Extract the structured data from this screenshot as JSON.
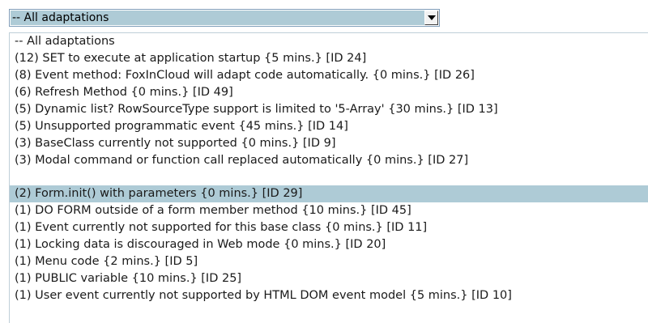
{
  "combo": {
    "selected_label": "-- All adaptations",
    "button_icon": "chevron-down-icon"
  },
  "dropdown": {
    "selected_index": 9,
    "selection_color": "#aecbd6",
    "options": [
      "-- All adaptations",
      "(12) SET to execute at application startup {5 mins.} [ID 24]",
      "(8) Event method: FoxInCloud will adapt code automatically. {0 mins.} [ID 26]",
      "(6) Refresh Method {0 mins.} [ID 49]",
      "(5) Dynamic list? RowSourceType support is limited to '5-Array' {30 mins.} [ID 13]",
      "(5) Unsupported programmatic event {45 mins.} [ID 14]",
      "(3) BaseClass currently not supported {0 mins.} [ID 9]",
      "(3) Modal command or function call replaced automatically {0 mins.} [ID 27]",
      "(2) Form.init() with parameters {0 mins.} [ID 29]",
      "(1) DO FORM outside of a form member method {10 mins.} [ID 45]",
      "(1) Event currently not supported for this base class {0 mins.} [ID 11]",
      "(1) Locking data is discouraged in Web mode {0 mins.} [ID 20]",
      "(1) Menu code {2 mins.} [ID 5]",
      "(1) PUBLIC variable {10 mins.} [ID 25]",
      "(1) User event currently not supported by HTML DOM event model {5 mins.} [ID 10]"
    ]
  }
}
